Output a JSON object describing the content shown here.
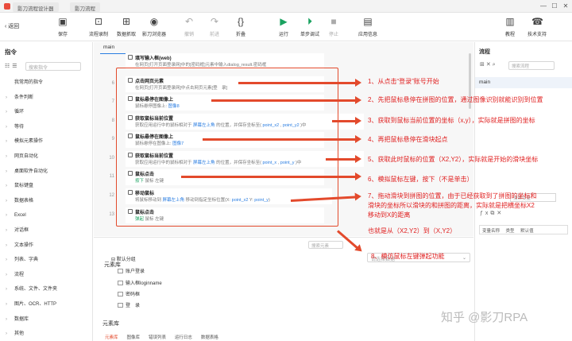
{
  "titlebar": {
    "tabs": [
      "影刀流程设计器",
      "影刀流程"
    ],
    "min": "—",
    "max": "☐",
    "close": "✕"
  },
  "toolbar": {
    "back": "返回",
    "buttons": [
      {
        "label": "保存",
        "icon": "save-icon",
        "glyph": "▣",
        "disabled": false
      },
      {
        "label": "流程录制",
        "icon": "record-icon",
        "glyph": "⊡",
        "disabled": false
      },
      {
        "label": "数据抓取",
        "icon": "grab-icon",
        "glyph": "⊞",
        "disabled": false
      },
      {
        "label": "影刀浏览器",
        "icon": "browser-icon",
        "glyph": "◉",
        "disabled": false
      },
      {
        "label": "撤销",
        "icon": "undo-icon",
        "glyph": "↶",
        "disabled": true
      },
      {
        "label": "前进",
        "icon": "redo-icon",
        "glyph": "↷",
        "disabled": true
      },
      {
        "label": "折叠",
        "icon": "fold-icon",
        "glyph": "{}",
        "disabled": false
      },
      {
        "label": "运行",
        "icon": "run-icon",
        "glyph": "▶",
        "disabled": false
      },
      {
        "label": "单步调试",
        "icon": "debug-icon",
        "glyph": "⏵",
        "disabled": false
      },
      {
        "label": "停止",
        "icon": "stop-icon",
        "glyph": "■",
        "disabled": true
      },
      {
        "label": "应用信息",
        "icon": "info-icon",
        "glyph": "▤",
        "disabled": false
      },
      {
        "label": "教程",
        "icon": "tutorial-icon",
        "glyph": "▥",
        "disabled": false
      },
      {
        "label": "技术支持",
        "icon": "support-icon",
        "glyph": "☎",
        "disabled": false
      }
    ]
  },
  "left": {
    "title": "指令",
    "search_placeholder": "搜索指令",
    "items": [
      "我常用的指令",
      "条件判断",
      "循环",
      "等待",
      "模拟元素操作",
      "网页自动化",
      "桌面软件自动化",
      "鼠标键盘",
      "数据表格",
      "Excel",
      "对话框",
      "文本操作",
      "列表、字典",
      "流程",
      "系统、文件、文件夹",
      "图片、OCR、HTTP",
      "数据库",
      "其他"
    ]
  },
  "center": {
    "tab": "main",
    "steps": [
      {
        "num": "",
        "title": "填写输入框(web)",
        "desc": "在网页[打开页面登录网]中的[密码框]元素中输入dialog_result.密码框"
      },
      {
        "num": "6",
        "title": "点击网页元素",
        "desc": "在网页[打开页面登录网]中点击网页元素[登　录]"
      },
      {
        "num": "7",
        "title": "鼠标悬停在图像上",
        "desc": "鼠标悬停图像上: 图像8"
      },
      {
        "num": "8",
        "title": "获取鼠标当前位置",
        "desc": "获取应用运行中的鼠标相对于 屏幕左上角 的位置，并保存坐标至( point_x2 , point_y2 )中"
      },
      {
        "num": "9",
        "title": "鼠标悬停在图像上",
        "desc": "鼠标悬停在图像上: 图像7"
      },
      {
        "num": "10",
        "title": "获取鼠标当前位置",
        "desc": "获取应用运行中的鼠标相对于 屏幕左上角 的位置，并保存坐标至( point_x , point_y )中"
      },
      {
        "num": "11",
        "title": "鼠标点击",
        "desc": "按下 鼠标 左键"
      },
      {
        "num": "12",
        "title": "移动鼠标",
        "desc": "将鼠标移动到 屏幕左上角 移动到指定坐标位置(X: point_x2 Y: point_y)"
      },
      {
        "num": "13",
        "title": "鼠标点击",
        "desc": "弹起 鼠标 左键"
      }
    ]
  },
  "elib": {
    "title": "元素库",
    "search_placeholder": "搜索元素",
    "tree": [
      "默认分组",
      "账户登录",
      "输入框loginname",
      "密码框",
      "登　录"
    ],
    "title2": "元素库",
    "bottom_tabs": [
      "元素库",
      "图像库",
      "错误列表",
      "运行日志",
      "数据表格"
    ],
    "dropdown_placeholder": "请选择数据"
  },
  "right": {
    "title": "流程",
    "search_placeholder": "搜索流程",
    "flow": "main",
    "var_search_placeholder": "搜索变量",
    "var_headers": [
      "变量名称",
      "类型",
      "默认值"
    ]
  },
  "annotations": [
    "1、从点击“登录”账号开始",
    "2、先把鼠标悬停在拼图的位置，通过图像识别就能识别到位置",
    "3、获取到鼠标当前位置的坐标（x,y），实际就是拼图的坐标",
    "4、再把鼠标悬停在滑块起点",
    "5、获取此时鼠标的位置（X2,Y2），实际就是开始的滑块坐标",
    "6、模拟鼠标左键，按下（不是单击）",
    "7、拖动滑块到拼图的位置，由于已经获取到了拼图的坐标和",
    "滑块的坐标所以滑块的和拼图的距离，实际就是把横坐标X2",
    "移动到X的距离",
    "也就是从（X2,Y2）到（X,Y2）",
    "8、模仿鼠标左键弹起功能"
  ],
  "watermark": "知乎 @影刀RPA"
}
